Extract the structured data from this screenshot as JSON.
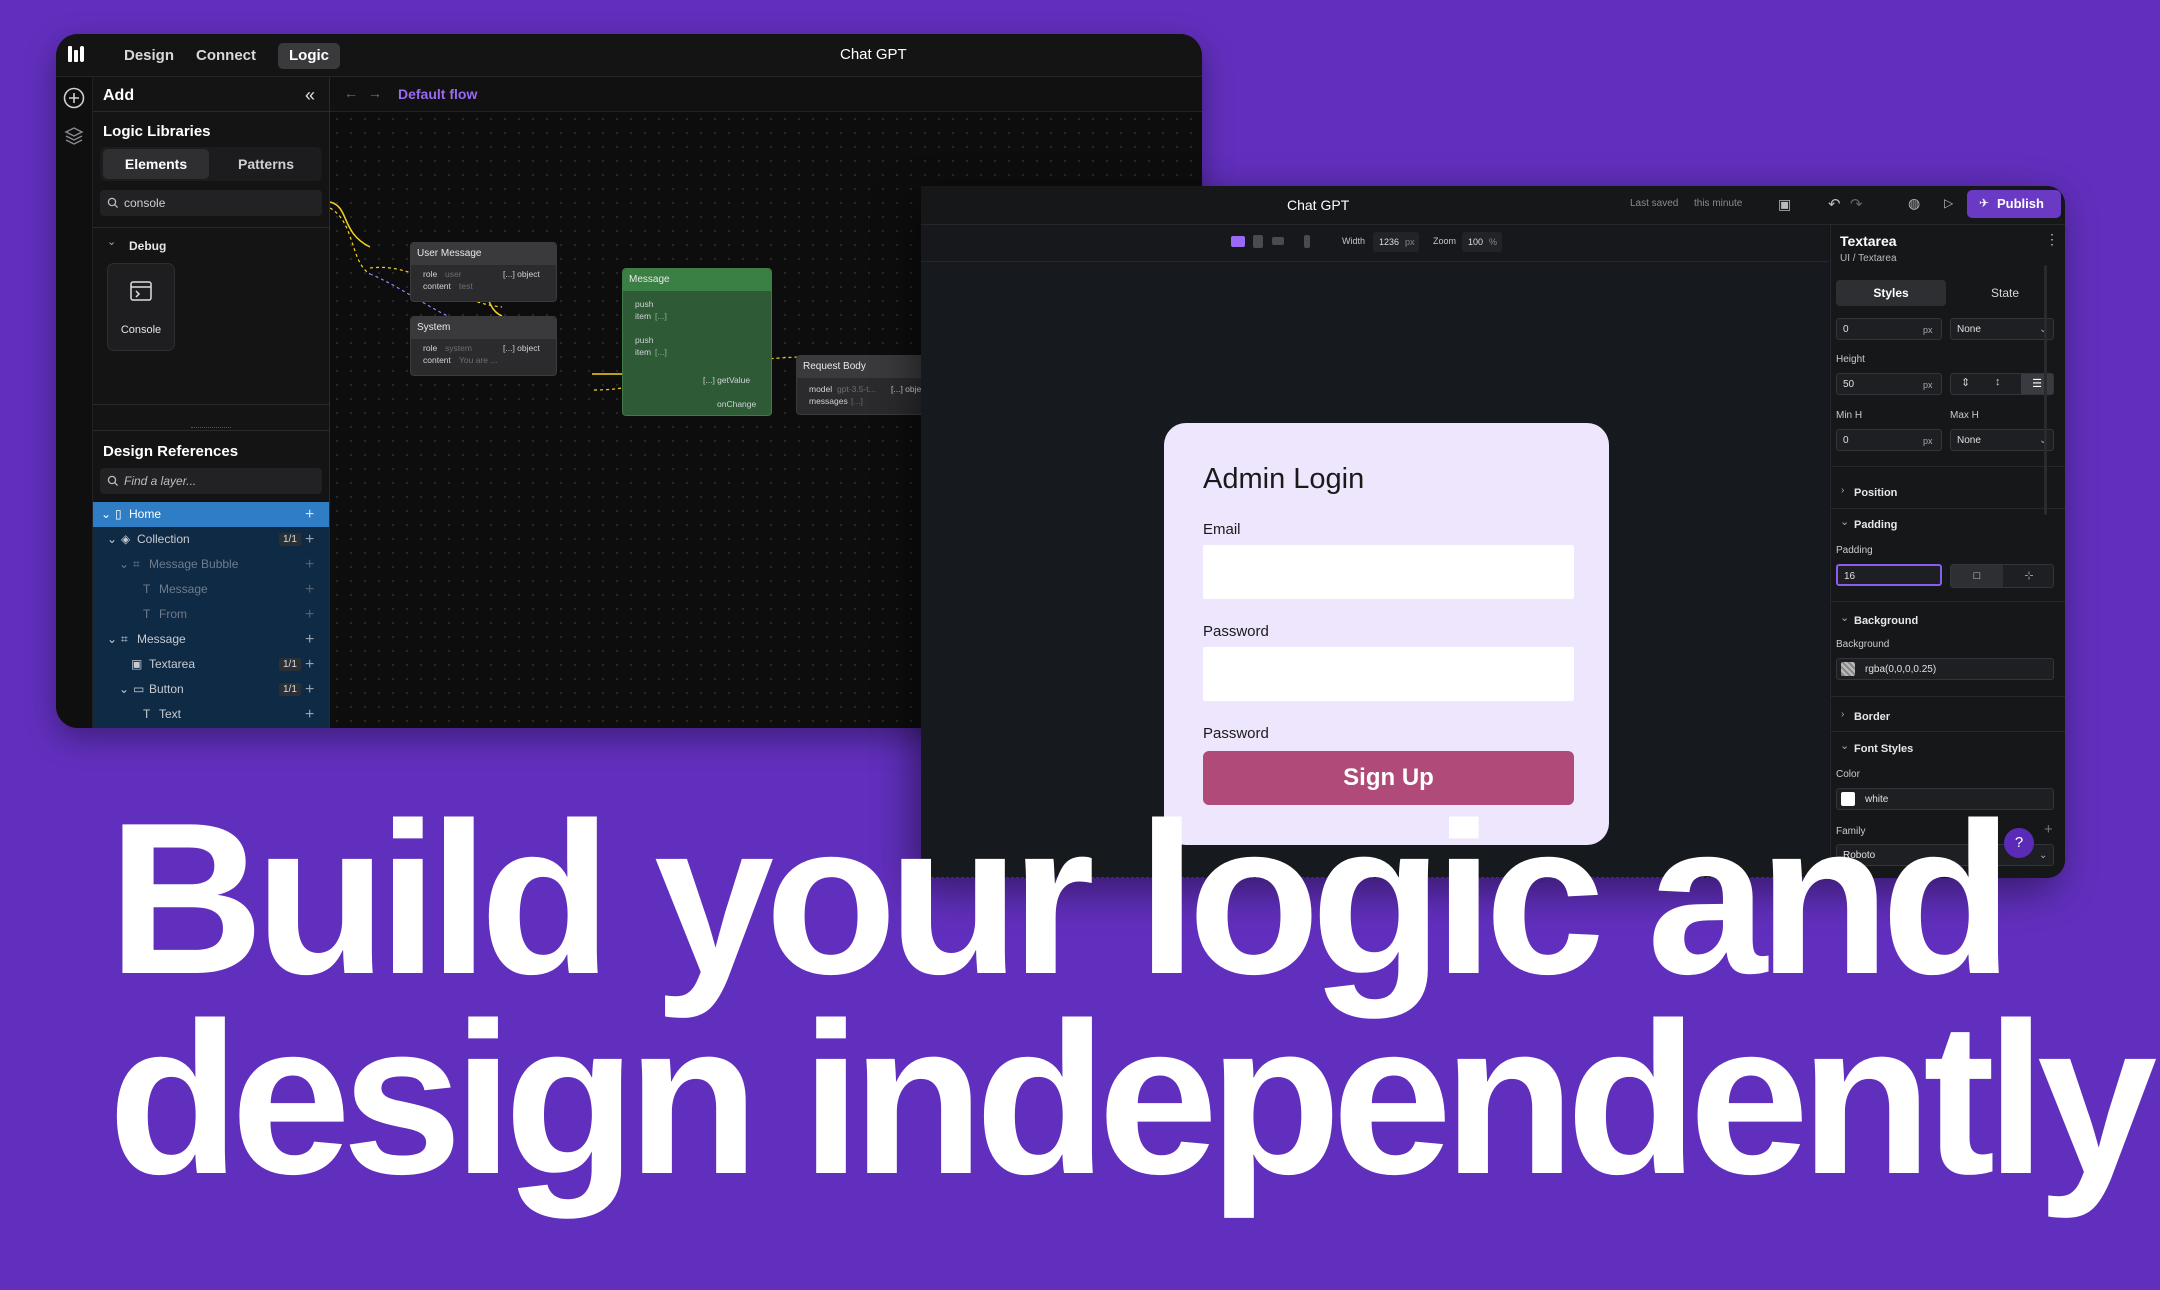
{
  "logic_window": {
    "tabs": [
      {
        "label": "Design"
      },
      {
        "label": "Connect"
      },
      {
        "label": "Logic"
      }
    ],
    "title": "Chat GPT",
    "add_panel": {
      "title": "Add",
      "libraries_title": "Logic Libraries",
      "seg_elements": "Elements",
      "seg_patterns": "Patterns",
      "search_value": "console",
      "debug_label": "Debug",
      "console_label": "Console",
      "design_refs_title": "Design References",
      "find_placeholder": "Find a layer...",
      "layers": [
        {
          "label": "Home"
        },
        {
          "label": "Collection",
          "count": "1/1"
        },
        {
          "label": "Message Bubble"
        },
        {
          "label": "Message"
        },
        {
          "label": "From"
        },
        {
          "label": "Message"
        },
        {
          "label": "Textarea",
          "count": "1/1"
        },
        {
          "label": "Button",
          "count": "1/1"
        },
        {
          "label": "Text"
        }
      ]
    },
    "flow_name": "Default flow",
    "nodes": {
      "user_message": {
        "title": "User Message",
        "row1": "role",
        "row1_val": "user",
        "row2": "content",
        "row2_val": "test",
        "out": "[...] object"
      },
      "system": {
        "title": "System",
        "row1": "role",
        "row1_val": "system",
        "row2": "content",
        "row2_val": "You are ...",
        "out": "[...] object"
      },
      "message": {
        "title": "Message",
        "r1": "push",
        "r2": "item",
        "r2_val": "[...]",
        "r3": "push",
        "r4": "item",
        "r4_val": "[...]",
        "out1": "[...] getValue",
        "out2": "onChange"
      },
      "request_body": {
        "title": "Request Body",
        "r1": "model",
        "r1_val": "gpt-3.5-t...",
        "r2": "messages",
        "r2_val": "[...]",
        "out": "[...] object"
      }
    }
  },
  "design_window": {
    "title": "Chat GPT",
    "last_saved_label": "Last saved",
    "last_saved_value": "this minute",
    "publish_label": "Publish",
    "width_label": "Width",
    "width_value": "1236",
    "width_unit": "px",
    "zoom_label": "Zoom",
    "zoom_value": "100",
    "zoom_unit": "%",
    "login_card": {
      "title": "Admin Login",
      "email_label": "Email",
      "password_label": "Password",
      "password2_label": "Password",
      "signup_label": "Sign Up"
    },
    "props": {
      "element_name": "Textarea",
      "element_path": "UI / Textarea",
      "tab_styles": "Styles",
      "tab_state": "State",
      "top_value": "0",
      "top_unit": "px",
      "top_none": "None",
      "height_label": "Height",
      "height_value": "50",
      "height_unit": "px",
      "minh_label": "Min H",
      "maxh_label": "Max H",
      "minh_value": "0",
      "minh_unit": "px",
      "maxh_value": "None",
      "position_label": "Position",
      "padding_section": "Padding",
      "padding_label": "Padding",
      "padding_value": "16",
      "background_section": "Background",
      "background_label": "Background",
      "background_value": "rgba(0,0,0,0.25)",
      "border_section": "Border",
      "font_section": "Font Styles",
      "color_label": "Color",
      "color_value": "white",
      "family_label": "Family",
      "family_value": "Roboto",
      "help": "?"
    }
  },
  "headline": {
    "line1": "Build your logic and",
    "line2": "design independently"
  },
  "colors": {
    "background": "#612fbd",
    "accent": "#9a6af4",
    "card": "#ede6fd",
    "signup": "#b04a78",
    "publish": "#6a3ac4",
    "node_green": "#2e5a35",
    "wire_yellow": "#f5d21f"
  }
}
